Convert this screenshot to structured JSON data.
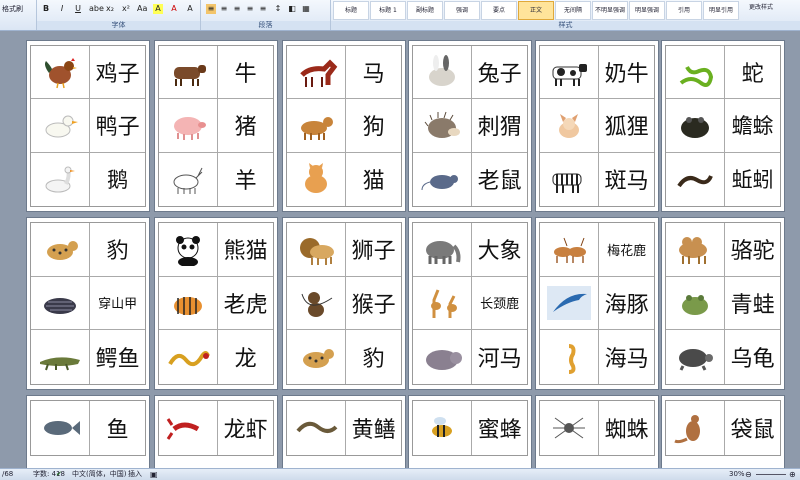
{
  "ribbon": {
    "format_painter": "格式刷",
    "font_group": "字体",
    "para_group": "段落",
    "styles_group": "样式",
    "font_buttons": [
      "B",
      "I",
      "U",
      "abe",
      "x₂",
      "x²",
      "Aa",
      "A",
      "A",
      "A"
    ],
    "styles": [
      "标题",
      "标题 1",
      "副标题",
      "强调",
      "要点",
      "正文",
      "无间隔",
      "不明显强调",
      "明显强调",
      "引用",
      "明显引用"
    ],
    "active_style_index": 5,
    "change_styles": "更改样式"
  },
  "pages": [
    {
      "rows": [
        {
          "animal": "chicken",
          "icon": "chicken-icon",
          "name": "鸡子",
          "size": "n1"
        },
        {
          "animal": "duck",
          "icon": "duck-icon",
          "name": "鸭子",
          "size": "n1"
        },
        {
          "animal": "goose",
          "icon": "goose-icon",
          "name": "鹅",
          "size": "n2"
        }
      ]
    },
    {
      "rows": [
        {
          "animal": "cow",
          "icon": "cow-icon",
          "name": "牛",
          "size": "n1"
        },
        {
          "animal": "pig",
          "icon": "pig-icon",
          "name": "猪",
          "size": "n1"
        },
        {
          "animal": "goat",
          "icon": "goat-icon",
          "name": "羊",
          "size": "n1"
        }
      ]
    },
    {
      "rows": [
        {
          "animal": "horse",
          "icon": "horse-icon",
          "name": "马",
          "size": "n1"
        },
        {
          "animal": "dog",
          "icon": "dog-icon",
          "name": "狗",
          "size": "n1"
        },
        {
          "animal": "cat",
          "icon": "cat-icon",
          "name": "猫",
          "size": "n1"
        }
      ]
    },
    {
      "rows": [
        {
          "animal": "rabbit",
          "icon": "rabbit-icon",
          "name": "兔子",
          "size": "n1"
        },
        {
          "animal": "hedgehog",
          "icon": "hedgehog-icon",
          "name": "刺猬",
          "size": "n1"
        },
        {
          "animal": "rat",
          "icon": "rat-icon",
          "name": "老鼠",
          "size": "n1"
        }
      ]
    },
    {
      "rows": [
        {
          "animal": "dairy-cow",
          "icon": "dairy-cow-icon",
          "name": "奶牛",
          "size": "n1"
        },
        {
          "animal": "fox",
          "icon": "fox-icon",
          "name": "狐狸",
          "size": "n1"
        },
        {
          "animal": "zebra",
          "icon": "zebra-icon",
          "name": "斑马",
          "size": "n1"
        }
      ]
    },
    {
      "rows": [
        {
          "animal": "snake",
          "icon": "snake-icon",
          "name": "蛇",
          "size": "n1"
        },
        {
          "animal": "toad",
          "icon": "toad-icon",
          "name": "蟾蜍",
          "size": "n2"
        },
        {
          "animal": "earthworm",
          "icon": "earthworm-icon",
          "name": "蚯蚓",
          "size": "n2"
        }
      ]
    },
    {
      "rows": [
        {
          "animal": "leopard",
          "icon": "leopard-icon",
          "name": "豹",
          "size": "n1"
        },
        {
          "animal": "pangolin",
          "icon": "pangolin-icon",
          "name": "穿山甲",
          "size": "n3"
        },
        {
          "animal": "crocodile",
          "icon": "crocodile-icon",
          "name": "鳄鱼",
          "size": "n1"
        }
      ]
    },
    {
      "rows": [
        {
          "animal": "panda",
          "icon": "panda-icon",
          "name": "熊猫",
          "size": "n1"
        },
        {
          "animal": "tiger",
          "icon": "tiger-icon",
          "name": "老虎",
          "size": "n1"
        },
        {
          "animal": "dragon",
          "icon": "dragon-icon",
          "name": "龙",
          "size": "n1"
        }
      ]
    },
    {
      "rows": [
        {
          "animal": "lion",
          "icon": "lion-icon",
          "name": "狮子",
          "size": "n1"
        },
        {
          "animal": "monkey",
          "icon": "monkey-icon",
          "name": "猴子",
          "size": "n1"
        },
        {
          "animal": "leopard",
          "icon": "leopard-icon",
          "name": "豹",
          "size": "n1"
        }
      ]
    },
    {
      "rows": [
        {
          "animal": "elephant",
          "icon": "elephant-icon",
          "name": "大象",
          "size": "n1"
        },
        {
          "animal": "giraffe",
          "icon": "giraffe-icon",
          "name": "长颈鹿",
          "size": "n3"
        },
        {
          "animal": "hippo",
          "icon": "hippo-icon",
          "name": "河马",
          "size": "n1"
        }
      ]
    },
    {
      "rows": [
        {
          "animal": "deer",
          "icon": "deer-icon",
          "name": "梅花鹿",
          "size": "n3"
        },
        {
          "animal": "dolphin",
          "icon": "dolphin-icon",
          "name": "海豚",
          "size": "n1"
        },
        {
          "animal": "seahorse",
          "icon": "seahorse-icon",
          "name": "海马",
          "size": "n1"
        }
      ]
    },
    {
      "rows": [
        {
          "animal": "camel",
          "icon": "camel-icon",
          "name": "骆驼",
          "size": "n1"
        },
        {
          "animal": "frog",
          "icon": "frog-icon",
          "name": "青蛙",
          "size": "n1"
        },
        {
          "animal": "turtle",
          "icon": "turtle-icon",
          "name": "乌龟",
          "size": "n1"
        }
      ]
    },
    {
      "rows": [
        {
          "animal": "fish",
          "icon": "fish-icon",
          "name": "鱼",
          "size": "n1"
        }
      ]
    },
    {
      "rows": [
        {
          "animal": "crayfish",
          "icon": "crayfish-icon",
          "name": "龙虾",
          "size": "n1"
        }
      ]
    },
    {
      "rows": [
        {
          "animal": "eel",
          "icon": "eel-icon",
          "name": "黄鳝",
          "size": "n1"
        }
      ]
    },
    {
      "rows": [
        {
          "animal": "bee",
          "icon": "bee-icon",
          "name": "蜜蜂",
          "size": "n1"
        }
      ]
    },
    {
      "rows": [
        {
          "animal": "spider",
          "icon": "spider-icon",
          "name": "蜘蛛",
          "size": "n1"
        }
      ]
    },
    {
      "rows": [
        {
          "animal": "kangaroo",
          "icon": "kangaroo-icon",
          "name": "袋鼠",
          "size": "n1"
        }
      ]
    }
  ],
  "status": {
    "page": "/68",
    "words": "字数: 418",
    "language": "中文(简体，中国)",
    "insert": "插入",
    "zoom": "30%"
  },
  "colors": {
    "background": "#8e9aab",
    "page": "#ffffff",
    "active_style": "#ffe49a"
  }
}
